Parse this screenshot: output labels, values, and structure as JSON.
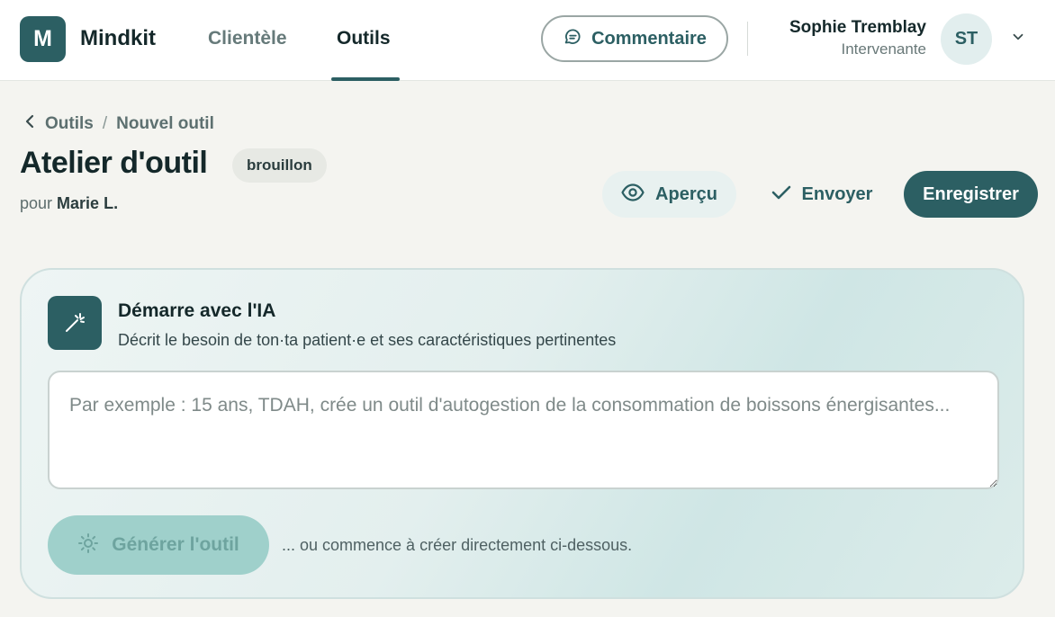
{
  "header": {
    "logo_letter": "M",
    "app_name": "Mindkit",
    "tabs": [
      {
        "label": "Clientèle",
        "active": false
      },
      {
        "label": "Outils",
        "active": true
      }
    ],
    "feedback_label": "Commentaire",
    "user": {
      "name": "Sophie Tremblay",
      "role": "Intervenante",
      "initials": "ST"
    }
  },
  "breadcrumb": {
    "back": "Outils",
    "separator": "/",
    "current": "Nouvel outil"
  },
  "page": {
    "title": "Atelier d'outil",
    "status": "brouillon",
    "subtitle_prefix": "pour",
    "client": "Marie L."
  },
  "actions": {
    "preview": "Aperçu",
    "send": "Envoyer",
    "save": "Enregistrer"
  },
  "ai_card": {
    "title": "Démarre avec l'IA",
    "description": "Décrit le besoin de ton·ta patient·e et ses caractéristiques pertinentes",
    "input_value": "",
    "placeholder": "Par exemple : 15 ans, TDAH, crée un outil d'autogestion de la consommation de boissons énergisantes...",
    "generate_label": "Générer l'outil",
    "hint": "... ou commence à créer directement ci-dessous."
  },
  "icons": {
    "back": "chevron-left-icon",
    "feedback": "chat-bubble-icon",
    "user_menu": "chevron-down-icon",
    "preview": "eye-icon",
    "send": "check-icon",
    "ai": "magic-wand-icon",
    "generate": "sparkle-icon"
  },
  "colors": {
    "primary": "#2c5f63",
    "background": "#f4f4f0",
    "generate_disabled": "#9fd0cb"
  }
}
